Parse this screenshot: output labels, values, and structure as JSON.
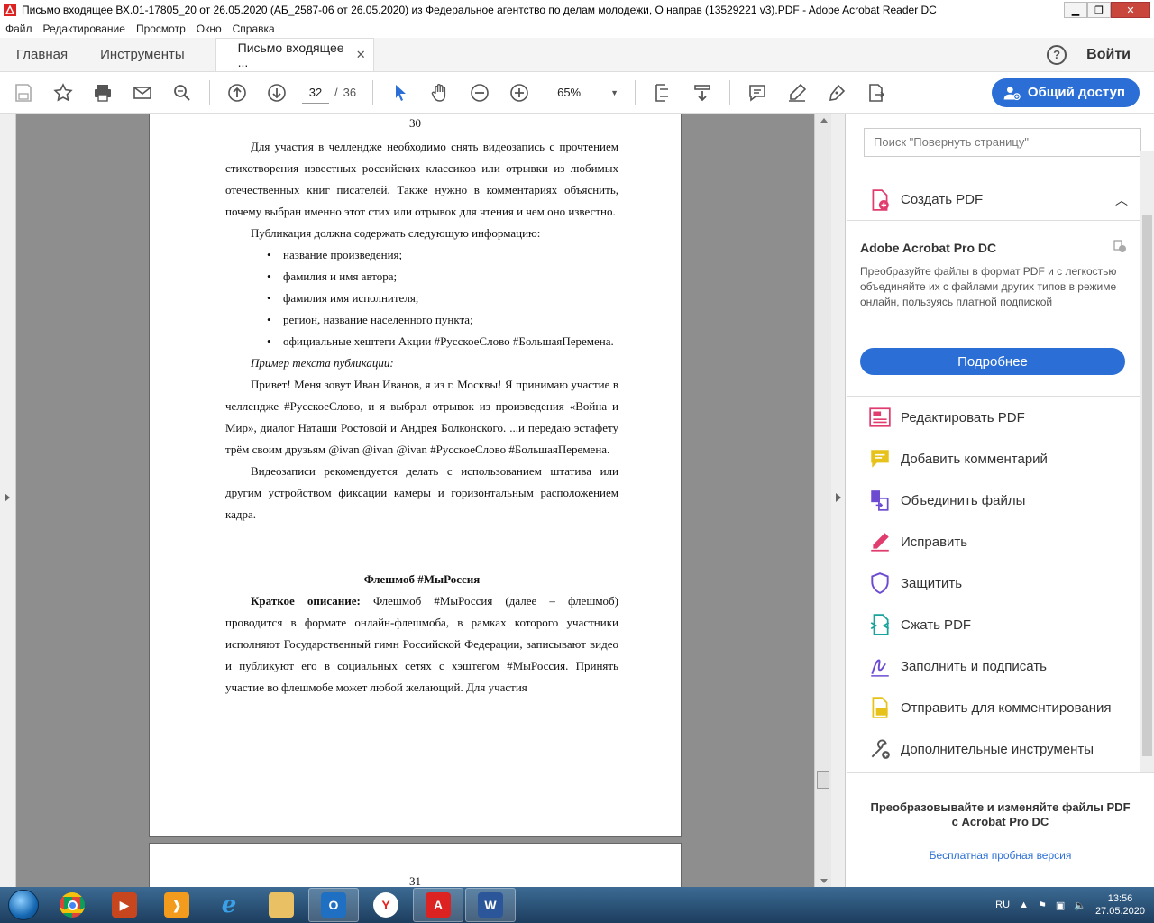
{
  "window": {
    "title": "Письмо входящее ВХ.01-17805_20 от 26.05.2020 (АБ_2587-06 от 26.05.2020) из Федеральное агентство по делам молодежи,  О направ (13529221 v3).PDF - Adobe Acrobat Reader DC"
  },
  "menu": [
    "Файл",
    "Редактирование",
    "Просмотр",
    "Окно",
    "Справка"
  ],
  "tabs": {
    "home": "Главная",
    "tools": "Инструменты",
    "document": "Письмо входящее ...",
    "close": "✕",
    "help": "?",
    "signin": "Войти"
  },
  "toolbar": {
    "page_current": "32",
    "page_sep": "/",
    "page_total": "36",
    "zoom": "65%",
    "share": "Общий доступ"
  },
  "document": {
    "page1_number": "30",
    "para1": "Для участия в челлендже необходимо снять видеозапись с прочтением стихотворения известных российских классиков или отрывки из любимых отечественных книг писателей. Также нужно в комментариях объяснить, почему выбран именно этот стих или отрывок для чтения и чем оно известно.",
    "para2": "Публикация должна содержать следующую информацию:",
    "bullets": [
      "название произведения;",
      "фамилия и имя автора;",
      "фамилия имя исполнителя;",
      "регион, название населенного пункта;",
      "официальные хештеги Акции #РусскоеСлово #БольшаяПеремена."
    ],
    "example_label": "Пример текста публикации:",
    "example_text": "Привет! Меня зовут Иван Иванов, я из г. Москвы! Я принимаю участие в челлендже #РусскоеСлово, и я выбрал отрывок из произведения «Война и Мир», диалог Наташи Ростовой и Андрея Болконского. ...и передаю эстафету трём своим друзьям @ivan @ivan @ivan #РусскоеСлово #БольшаяПеремена.",
    "para3": "Видеозаписи рекомендуется делать с использованием штатива или другим устройством фиксации камеры и горизонтальным расположением кадра.",
    "heading": "Флешмоб #МыРоссия",
    "desc_label": "Краткое описание:",
    "desc_text": " Флешмоб #МыРоссия (далее – флешмоб) проводится в формате онлайн-флешмоба, в рамках которого участники исполняют Государственный гимн Российской Федерации, записывают видео и публикуют его в социальных сетях с хэштегом #МыРоссия. Принять участие во флешмобе может любой желающий. Для участия",
    "page2_number": "31"
  },
  "right_panel": {
    "search_placeholder": "Поиск \"Повернуть страницу\"",
    "create_pdf": "Создать PDF",
    "promo_title": "Adobe Acrobat Pro DC",
    "promo_text": "Преобразуйте файлы в формат PDF и с легкостью объединяйте их с файлами других типов в режиме онлайн, пользуясь платной подпиской",
    "promo_button": "Подробнее",
    "tools": [
      {
        "label": "Редактировать PDF",
        "icon": "edit-pdf-icon",
        "color": "#e03c6e"
      },
      {
        "label": "Добавить комментарий",
        "icon": "comment-icon",
        "color": "#e6c21a"
      },
      {
        "label": "Объединить файлы",
        "icon": "combine-files-icon",
        "color": "#6c4bd1"
      },
      {
        "label": "Исправить",
        "icon": "fix-pen-icon",
        "color": "#e03c6e"
      },
      {
        "label": "Защитить",
        "icon": "shield-icon",
        "color": "#6c4bd1"
      },
      {
        "label": "Сжать PDF",
        "icon": "compress-pdf-icon",
        "color": "#1aa39a"
      },
      {
        "label": "Заполнить и подписать",
        "icon": "fill-sign-icon",
        "color": "#6c4bd1"
      },
      {
        "label": "Отправить для комментирования",
        "icon": "send-review-icon",
        "color": "#e6c21a"
      },
      {
        "label": "Дополнительные инструменты",
        "icon": "more-tools-icon",
        "color": "#555555"
      }
    ],
    "footer_text": "Преобразовывайте и изменяйте файлы PDF с Acrobat Pro DC",
    "footer_link": "Бесплатная пробная версия"
  },
  "taskbar": {
    "lang": "RU",
    "time": "13:56",
    "date": "27.05.2020"
  }
}
